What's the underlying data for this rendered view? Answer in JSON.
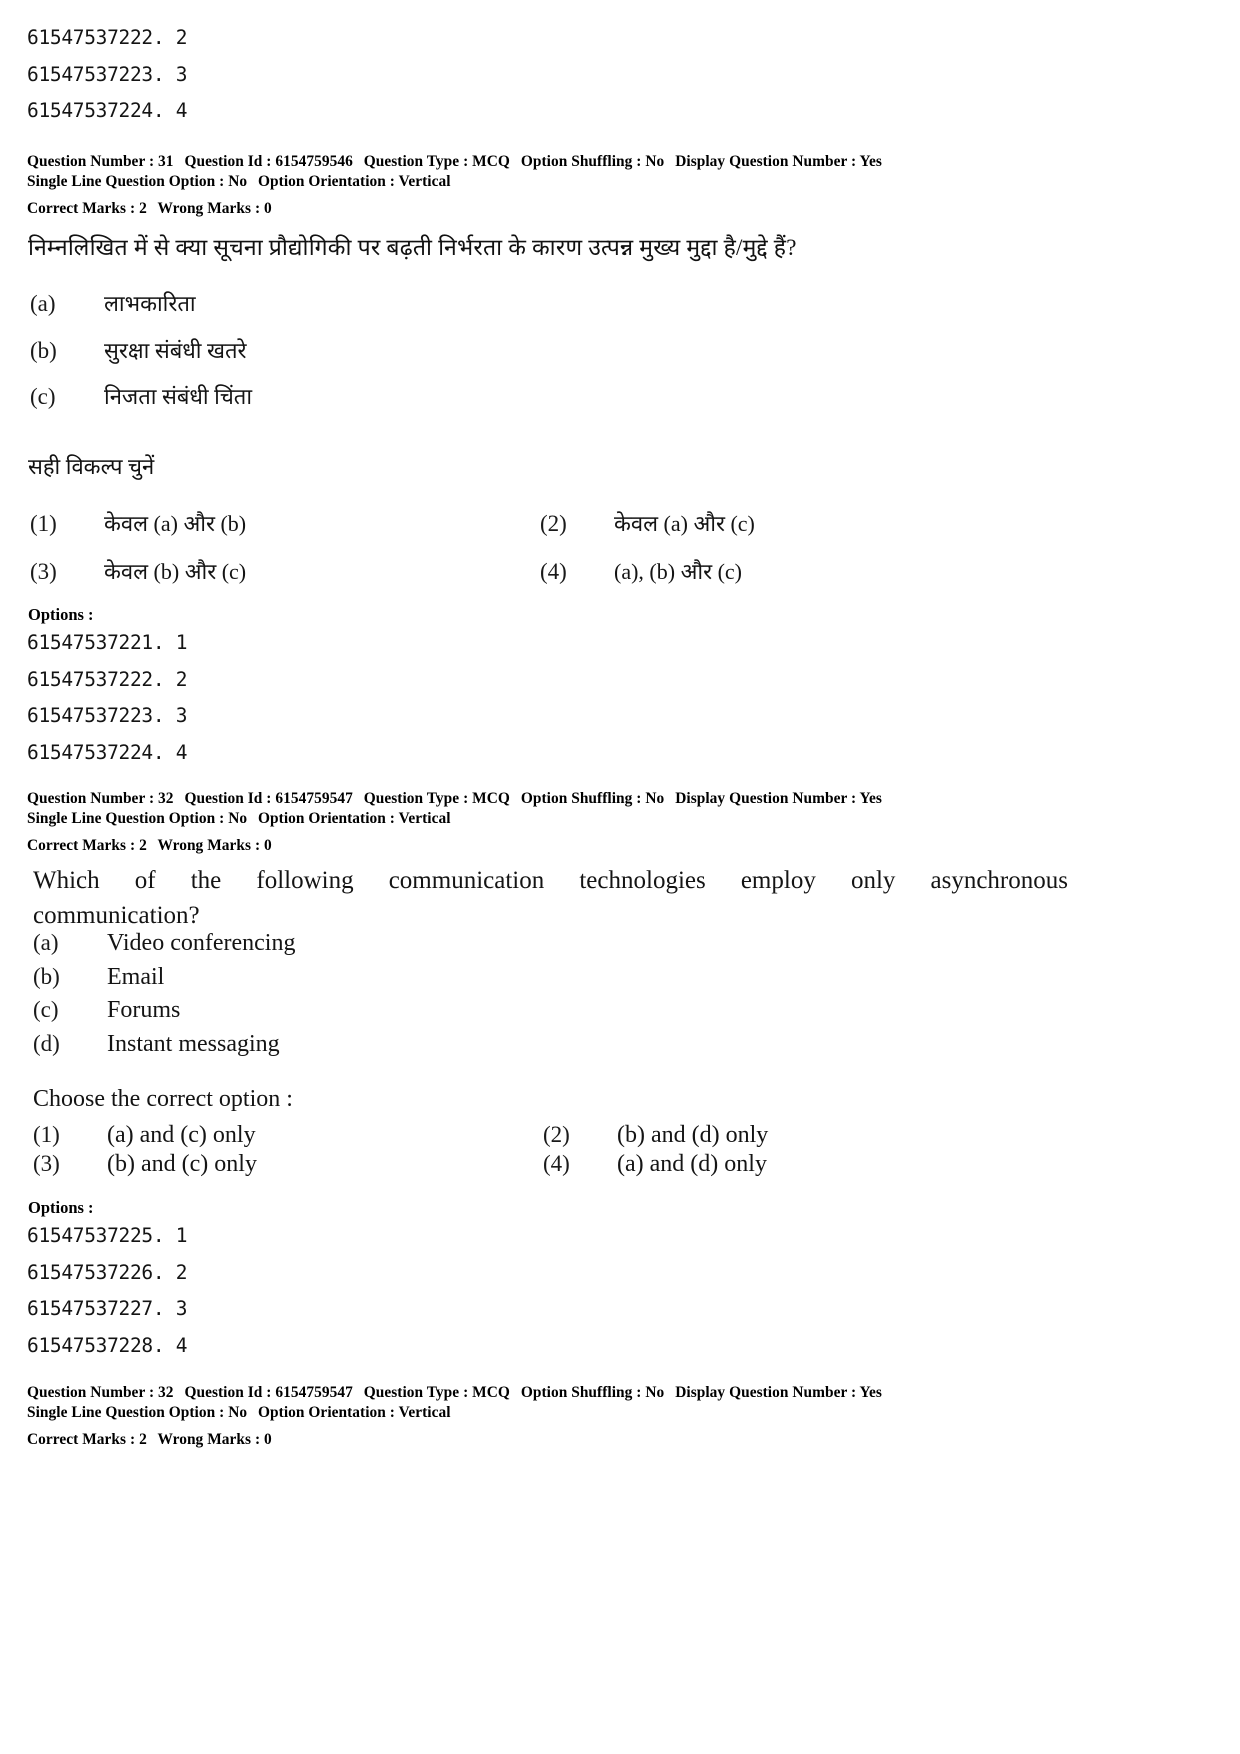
{
  "page": {
    "top_option_ids": [
      "61547537222. 2",
      "61547537223. 3",
      "61547537224. 4"
    ]
  },
  "question_31": {
    "meta": {
      "question_number_label": "Question Number :",
      "question_number": "31",
      "question_id_label": "Question Id :",
      "question_id": "6154759546",
      "question_type_label": "Question Type :",
      "question_type": "MCQ",
      "option_shuffling_label": "Option Shuffling :",
      "option_shuffling": "No",
      "display_question_number_label": "Display Question Number :",
      "display_question_number": "Yes",
      "single_line_question_option_label": "Single Line Question Option :",
      "single_line_question_option": "No",
      "option_orientation_label": "Option Orientation :",
      "option_orientation": "Vertical",
      "correct_marks_label": "Correct Marks :",
      "correct_marks": "2",
      "wrong_marks_label": "Wrong Marks :",
      "wrong_marks": "0"
    },
    "stem": "निम्नलिखित में से क्या सूचना प्रौद्योगिकी पर बढ़ती निर्भरता के कारण उत्पन्न मुख्य मुद्दा है/मुद्दे हैं?",
    "statements": [
      {
        "label": "(a)",
        "text": "लाभकारिता"
      },
      {
        "label": "(b)",
        "text": "सुरक्षा संबंधी खतरे"
      },
      {
        "label": "(c)",
        "text": "निजता संबंधी चिंता"
      }
    ],
    "instruction": "सही विकल्प चुनें",
    "choices": [
      {
        "num": "(1)",
        "text": "केवल (a) और (b)"
      },
      {
        "num": "(2)",
        "text": "केवल (a) और (c)"
      },
      {
        "num": "(3)",
        "text": "केवल (b) और (c)"
      },
      {
        "num": "(4)",
        "text": "(a), (b) और (c)"
      }
    ],
    "options_label": "Options :",
    "option_ids": [
      "61547537221. 1",
      "61547537222. 2",
      "61547537223. 3",
      "61547537224. 4"
    ]
  },
  "question_32": {
    "meta": {
      "question_number_label": "Question Number :",
      "question_number": "32",
      "question_id_label": "Question Id :",
      "question_id": "6154759547",
      "question_type_label": "Question Type :",
      "question_type": "MCQ",
      "option_shuffling_label": "Option Shuffling :",
      "option_shuffling": "No",
      "display_question_number_label": "Display Question Number :",
      "display_question_number": "Yes",
      "single_line_question_option_label": "Single Line Question Option :",
      "single_line_question_option": "No",
      "option_orientation_label": "Option Orientation :",
      "option_orientation": "Vertical",
      "correct_marks_label": "Correct Marks :",
      "correct_marks": "2",
      "wrong_marks_label": "Wrong Marks :",
      "wrong_marks": "0"
    },
    "stem_line_1": "Which of the following communication technologies employ only asynchronous",
    "stem_line_2": "communication?",
    "statements": [
      {
        "label": "(a)",
        "text": "Video conferencing"
      },
      {
        "label": "(b)",
        "text": "Email"
      },
      {
        "label": "(c)",
        "text": "Forums"
      },
      {
        "label": "(d)",
        "text": "Instant messaging"
      }
    ],
    "instruction": "Choose the correct option :",
    "choices": [
      {
        "num": "(1)",
        "text": "(a) and (c) only"
      },
      {
        "num": "(2)",
        "text": "(b) and (d) only"
      },
      {
        "num": "(3)",
        "text": "(b) and (c) only"
      },
      {
        "num": "(4)",
        "text": "(a) and (d) only"
      }
    ],
    "options_label": "Options :",
    "option_ids": [
      "61547537225. 1",
      "61547537226. 2",
      "61547537227. 3",
      "61547537228. 4"
    ]
  },
  "footer_meta": {
    "question_number_label": "Question Number :",
    "question_number": "32",
    "question_id_label": "Question Id :",
    "question_id": "6154759547",
    "question_type_label": "Question Type :",
    "question_type": "MCQ",
    "option_shuffling_label": "Option Shuffling :",
    "option_shuffling": "No",
    "display_question_number_label": "Display Question Number :",
    "display_question_number": "Yes",
    "single_line_question_option_label": "Single Line Question Option :",
    "single_line_question_option": "No",
    "option_orientation_label": "Option Orientation :",
    "option_orientation": "Vertical",
    "correct_marks_label": "Correct Marks :",
    "correct_marks": "2",
    "wrong_marks_label": "Wrong Marks :",
    "wrong_marks": "0"
  }
}
